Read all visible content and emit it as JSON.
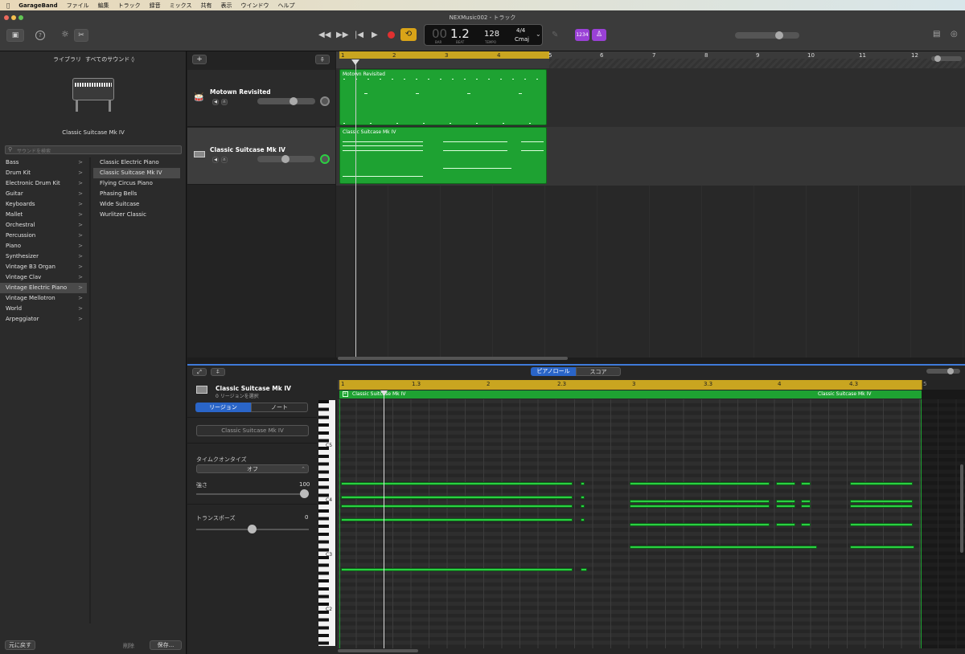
{
  "menubar": {
    "app": "GarageBand",
    "items": [
      "ファイル",
      "編集",
      "トラック",
      "録音",
      "ミックス",
      "共有",
      "表示",
      "ウインドウ",
      "ヘルプ"
    ]
  },
  "window": {
    "title": "NEXMusic002 - トラック"
  },
  "lcd": {
    "bar": "00",
    "beat": "1.2",
    "bar_label": "BAR",
    "beat_label": "BEAT",
    "tempo": "128",
    "tempo_label": "TEMPO",
    "signature": "4/4",
    "key": "Cmaj"
  },
  "toolbar": {
    "count_in": "1234",
    "colors": {
      "accent": "#9a41d6",
      "cycle": "#d9a418",
      "record": "#e03030"
    }
  },
  "library": {
    "header_lib": "ライブラリ",
    "header_sounds": "すべてのサウンド ◊",
    "instrument_name": "Classic Suitcase Mk IV",
    "search_placeholder": "サウンドを検索",
    "categories": [
      "Bass",
      "Drum Kit",
      "Electronic Drum Kit",
      "Guitar",
      "Keyboards",
      "Mallet",
      "Orchestral",
      "Percussion",
      "Piano",
      "Synthesizer",
      "Vintage B3 Organ",
      "Vintage Clav",
      "Vintage Electric Piano",
      "Vintage Mellotron",
      "World",
      "Arpeggiator"
    ],
    "selected_category": "Vintage Electric Piano",
    "patches": [
      "Classic Electric Piano",
      "Classic Suitcase Mk IV",
      "Flying Circus Piano",
      "Phasing Bells",
      "Wide Suitcase",
      "Wurlitzer Classic"
    ],
    "selected_patch": "Classic Suitcase Mk IV",
    "revert": "元に戻す",
    "delete": "削除",
    "save": "保存..."
  },
  "tracks": [
    {
      "name": "Motown Revisited",
      "region": "Motown Revisited"
    },
    {
      "name": "Classic Suitcase Mk IV",
      "region": "Classic Suitcase Mk IV"
    }
  ],
  "ruler": [
    "1",
    "2",
    "3",
    "4",
    "5",
    "6",
    "7",
    "8",
    "9",
    "10",
    "11",
    "12"
  ],
  "editor": {
    "tab_piano": "ピアノロール",
    "tab_score": "スコア",
    "track_name": "Classic Suitcase Mk IV",
    "region_count": "0 リージョンを選択",
    "seg_region": "リージョン",
    "seg_note": "ノート",
    "region_name": "Classic Suitcase Mk IV",
    "quantize_label": "タイムクオンタイズ",
    "quantize_value": "オフ",
    "strength_label": "強さ",
    "strength_value": "100",
    "transpose_label": "トランスポーズ",
    "transpose_value": "0",
    "ruler": [
      "1",
      "1.3",
      "2",
      "2.3",
      "3",
      "3.3",
      "4",
      "4.3",
      "5"
    ],
    "region_label_left": "Classic Suitcase Mk IV",
    "region_label_right": "Classic Suitcase Mk IV",
    "keys": [
      "C5",
      "C4",
      "C3",
      "C2"
    ]
  }
}
